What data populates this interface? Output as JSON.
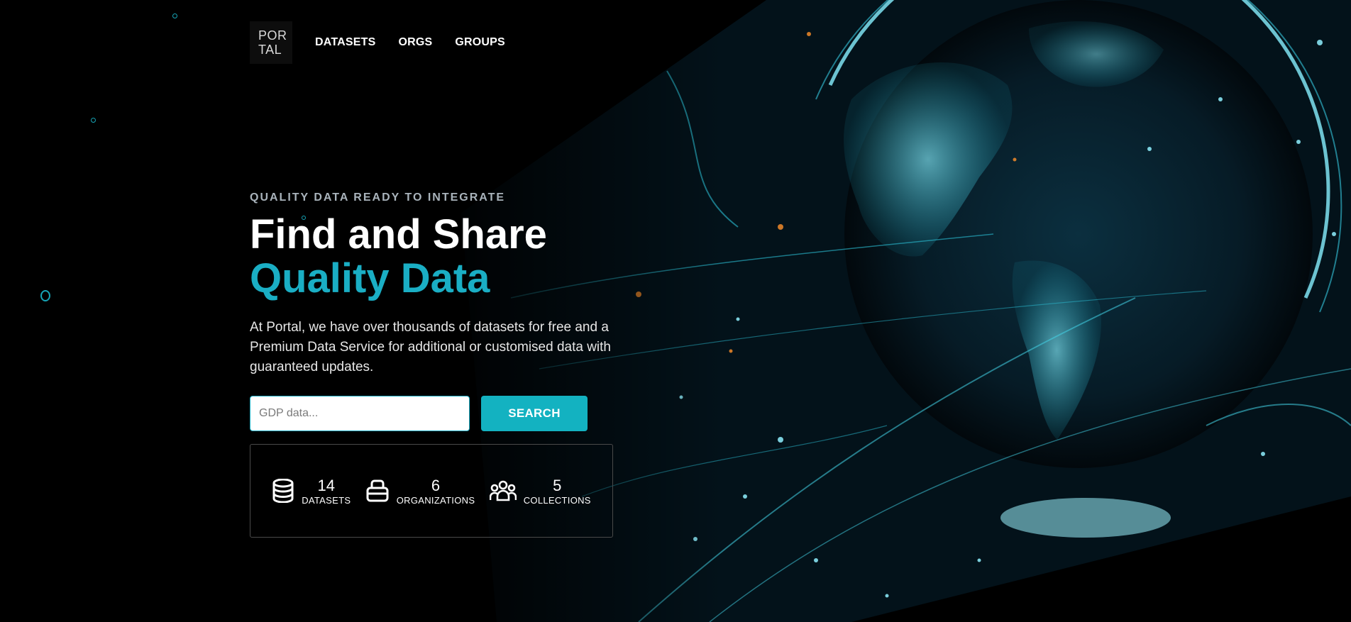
{
  "header": {
    "logo_line1": "POR",
    "logo_line2": "TAL",
    "nav": [
      {
        "label": "DATASETS"
      },
      {
        "label": "ORGS"
      },
      {
        "label": "GROUPS"
      }
    ]
  },
  "hero": {
    "eyebrow": "QUALITY DATA READY TO INTEGRATE",
    "title_line1": "Find and Share",
    "title_line2": "Quality Data",
    "description": "At Portal, we have over thousands of datasets for free and a Premium Data Service for additional or customised data with guaranteed updates.",
    "search": {
      "placeholder": "GDP data...",
      "value": "",
      "button_label": "SEARCH"
    }
  },
  "stats": [
    {
      "icon": "database-icon",
      "value": "14",
      "label": "DATASETS"
    },
    {
      "icon": "building-icon",
      "value": "6",
      "label": "ORGANIZATIONS"
    },
    {
      "icon": "people-group-icon",
      "value": "5",
      "label": "COLLECTIONS"
    }
  ],
  "colors": {
    "accent": "#1aaec4",
    "button": "#13b2c1",
    "background": "#000000"
  },
  "background_image": "glowing digital globe with network lines"
}
